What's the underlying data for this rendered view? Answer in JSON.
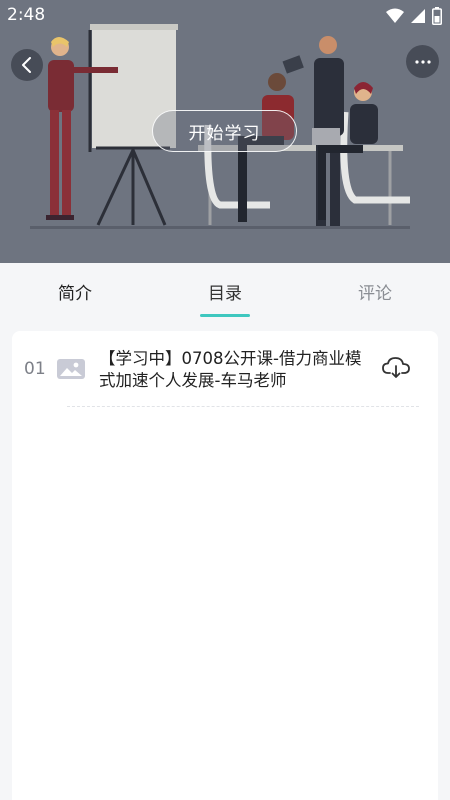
{
  "status_bar": {
    "time": "2:48",
    "icons": [
      "wifi-icon",
      "signal-icon",
      "battery-icon"
    ]
  },
  "header": {
    "back_icon": "back-chevron-icon",
    "more_icon": "more-dots-icon",
    "start_button_label": "开始学习"
  },
  "tabs": [
    {
      "label": "简介",
      "active": false
    },
    {
      "label": "目录",
      "active": true
    },
    {
      "label": "评论",
      "active": false
    }
  ],
  "catalog": {
    "items": [
      {
        "index": "01",
        "title": "【学习中】0708公开课-借力商业模式加速个人发展-车马老师",
        "thumb_icon": "image-placeholder-icon",
        "action_icon": "cloud-download-icon"
      }
    ]
  },
  "colors": {
    "accent": "#3ec7bf",
    "hero_overlay": "#6e7480",
    "page_bg": "#f5f6f8"
  }
}
